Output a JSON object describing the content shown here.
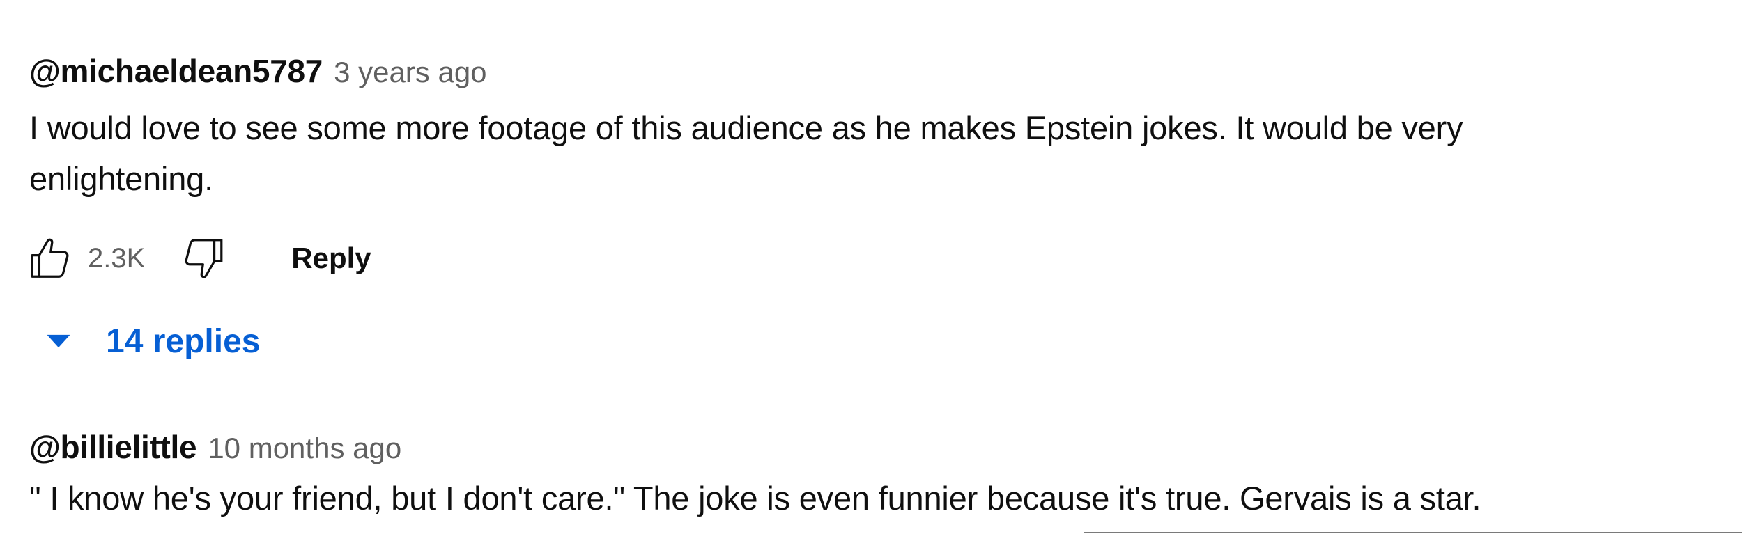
{
  "comments": [
    {
      "author": "@michaeldean5787",
      "time": "3 years ago",
      "text": "I would love to see some more footage of this audience as he makes Epstein jokes. It would be very enlightening.",
      "likes": "2.3K",
      "reply_label": "Reply",
      "replies_label": "14 replies"
    },
    {
      "author": "@billielittle",
      "time": "10 months ago",
      "text": "\" I know he's your friend, but I don't care.\" The joke is even funnier because it's true. Gervais is a star."
    }
  ],
  "icons": {
    "like": "thumbs-up-icon",
    "dislike": "thumbs-down-icon",
    "expand": "caret-down-icon"
  },
  "colors": {
    "text": "#0f0f0f",
    "secondary": "#606060",
    "link": "#065fd4"
  }
}
